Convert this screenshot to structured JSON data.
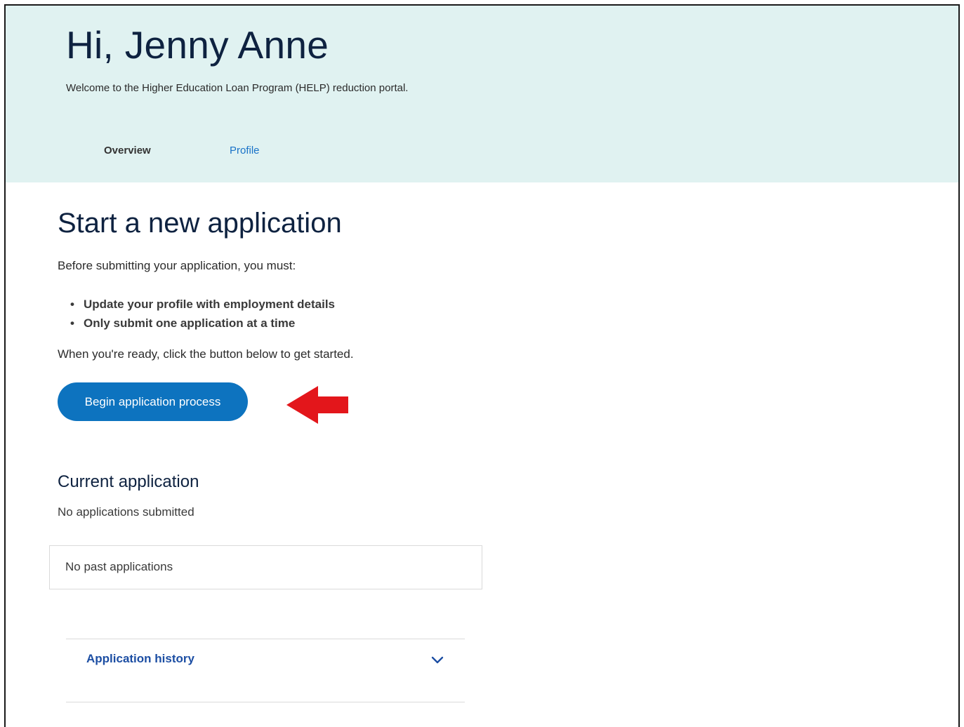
{
  "header": {
    "greeting": "Hi, Jenny Anne",
    "welcome": "Welcome to the Higher Education Loan Program (HELP) reduction portal.",
    "tabs": [
      {
        "label": "Overview",
        "active": true
      },
      {
        "label": "Profile",
        "active": false
      }
    ],
    "background_color": "#e0f2f1"
  },
  "start": {
    "title": "Start a new application",
    "intro": "Before submitting your application, you must:",
    "requirements": [
      "Update your profile with employment details",
      "Only submit one application at a time"
    ],
    "ready_text": "When you're ready, click the button below to get started.",
    "begin_button": "Begin application process",
    "button_color": "#0d73bf",
    "annotation_arrow_color": "#e3161b"
  },
  "current": {
    "title": "Current application",
    "status": "No applications submitted"
  },
  "past": {
    "status": "No past applications"
  },
  "history": {
    "label": "Application history",
    "icon": "chevron-down-icon",
    "expanded": false
  }
}
